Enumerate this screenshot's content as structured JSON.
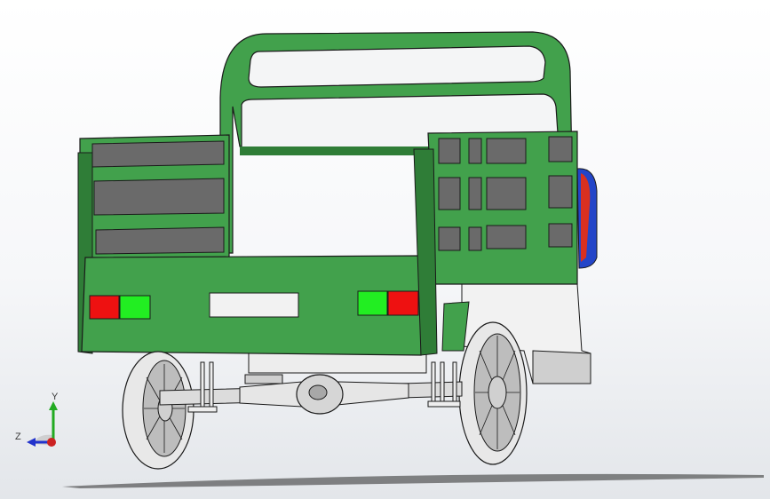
{
  "viewport": {
    "background_top": "#ffffff",
    "background_bottom": "#e3e6ea"
  },
  "model": {
    "body_color": "#42a14c",
    "body_dark": "#2f7d37",
    "outline": "#1a1a1a",
    "slot_color": "#6a6a6a",
    "tail_light_red": "#ee1111",
    "tail_light_green": "#22ee22",
    "plate_color": "#f2f2f2",
    "axle_color": "#dcdcdc",
    "tire_color": "#e8e8e8",
    "spare_blue": "#2345c8",
    "spare_red": "#d93020"
  },
  "triad": {
    "y_label": "Y",
    "z_label": "Z",
    "y_color": "#22aa22",
    "z_color": "#2233cc",
    "x_color": "#cc2222"
  }
}
